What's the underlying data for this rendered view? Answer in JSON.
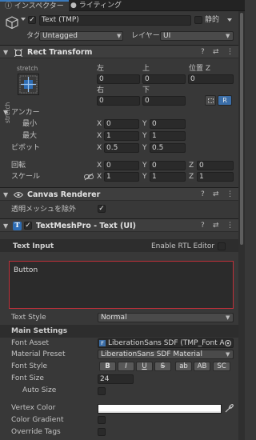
{
  "tabs": [
    {
      "label": "インスペクター",
      "icon": "info-icon"
    },
    {
      "label": "ライティング",
      "icon": "lightbulb-icon"
    }
  ],
  "object": {
    "active": true,
    "name": "Text (TMP)",
    "static_label": "静的",
    "tag_label": "タグ",
    "tag_value": "Untagged",
    "layer_label": "レイヤー",
    "layer_value": "UI"
  },
  "rect_transform": {
    "title": "Rect Transform",
    "stretch_top": "stretch",
    "stretch_side": "stretch",
    "col_left": "左",
    "col_top": "上",
    "col_posz": "位置 Z",
    "col_right": "右",
    "col_bottom": "下",
    "left": "0",
    "top": "0",
    "posz": "0",
    "right": "0",
    "bottom": "0",
    "raw_btn": "R",
    "anchors_label": "アンカー",
    "min_label": "最小",
    "max_label": "最大",
    "min_x": "0",
    "min_y": "0",
    "max_x": "1",
    "max_y": "1",
    "pivot_label": "ピボット",
    "pivot_x": "0.5",
    "pivot_y": "0.5",
    "rotation_label": "回転",
    "rot_x": "0",
    "rot_y": "0",
    "rot_z": "0",
    "scale_label": "スケール",
    "scale_x": "1",
    "scale_y": "1",
    "scale_z": "1",
    "axis_x": "X",
    "axis_y": "Y",
    "axis_z": "Z"
  },
  "canvas_renderer": {
    "title": "Canvas Renderer",
    "cull_label": "透明メッシュを除外",
    "cull_checked": true
  },
  "tmp": {
    "title": "TextMeshPro - Text (UI)",
    "text_input_label": "Text Input",
    "rtl_label": "Enable RTL Editor",
    "text_value": "Button",
    "text_style_label": "Text Style",
    "text_style_value": "Normal",
    "main_settings_label": "Main Settings",
    "font_asset_label": "Font Asset",
    "font_asset_value": "LiberationSans SDF (TMP_Font A",
    "material_preset_label": "Material Preset",
    "material_preset_value": "LiberationSans SDF Material",
    "font_style_label": "Font Style",
    "font_style_buttons": [
      "B",
      "I",
      "U",
      "S",
      "ab",
      "AB",
      "SC"
    ],
    "font_size_label": "Font Size",
    "font_size_value": "24",
    "auto_size_label": "Auto Size",
    "vertex_color_label": "Vertex Color",
    "vertex_color_hex": "#ffffff",
    "color_gradient_label": "Color Gradient",
    "override_tags_label": "Override Tags"
  },
  "colors": {
    "accent": "#3a79bb",
    "error_border": "#c0303a",
    "panel_bg": "#383838"
  }
}
